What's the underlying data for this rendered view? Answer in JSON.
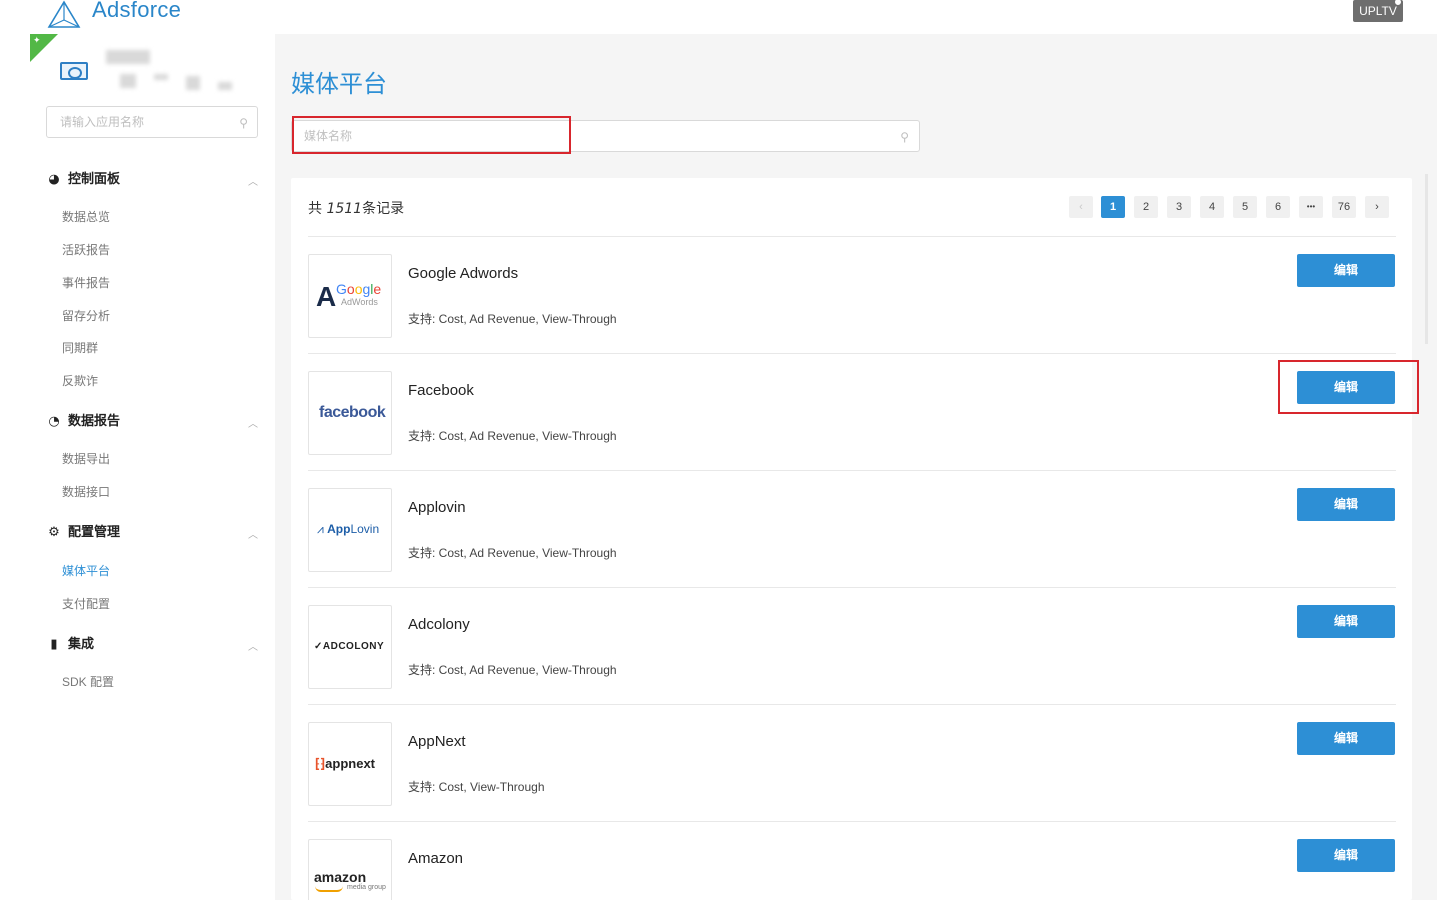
{
  "header": {
    "logo_text": "Adsforce",
    "brand_badge": "UPLTV"
  },
  "sidebar": {
    "search_placeholder": "请输入应用名称",
    "groups": [
      {
        "label": "控制面板",
        "icon": "dashboard-icon",
        "items": [
          "数据总览",
          "活跃报告",
          "事件报告",
          "留存分析",
          "同期群",
          "反欺诈"
        ]
      },
      {
        "label": "数据报告",
        "icon": "pie-chart-icon",
        "items": [
          "数据导出",
          "数据接口"
        ]
      },
      {
        "label": "配置管理",
        "icon": "gear-icon",
        "items": [
          "媒体平台",
          "支付配置"
        ]
      },
      {
        "label": "集成",
        "icon": "bar-chart-icon",
        "items": [
          "SDK 配置"
        ]
      }
    ],
    "active_item": "媒体平台"
  },
  "main": {
    "title": "媒体平台",
    "search_placeholder": "媒体名称",
    "total_prefix": "共 ",
    "total_count": "1511",
    "total_suffix": "条记录",
    "pagination": {
      "prev": "‹",
      "pages": [
        "1",
        "2",
        "3",
        "4",
        "5",
        "6",
        "•••",
        "76"
      ],
      "next": "›",
      "current": "1"
    },
    "edit_label": "编辑",
    "media": [
      {
        "name": "Google Adwords",
        "support": "支持: Cost, Ad Revenue, View-Through",
        "logo": {
          "mark": "A",
          "word": "Google",
          "sub": "AdWords"
        }
      },
      {
        "name": "Facebook",
        "support": "支持: Cost, Ad Revenue, View-Through",
        "logo": {
          "word": "facebook"
        }
      },
      {
        "name": "Applovin",
        "support": "支持: Cost, Ad Revenue, View-Through",
        "logo": {
          "word_bold": "App",
          "word": "Lovin"
        }
      },
      {
        "name": "Adcolony",
        "support": "支持: Cost, Ad Revenue, View-Through",
        "logo": {
          "word": "ADCOLONY"
        }
      },
      {
        "name": "AppNext",
        "support": "支持: Cost, View-Through",
        "logo": {
          "word": "appnext"
        }
      },
      {
        "name": "Amazon",
        "support": "",
        "logo": {
          "word": "amazon",
          "sub": "media group"
        }
      }
    ]
  },
  "colors": {
    "accent": "#2d8fd5",
    "highlight_red": "#d8262d",
    "android_green": "#52b846"
  }
}
